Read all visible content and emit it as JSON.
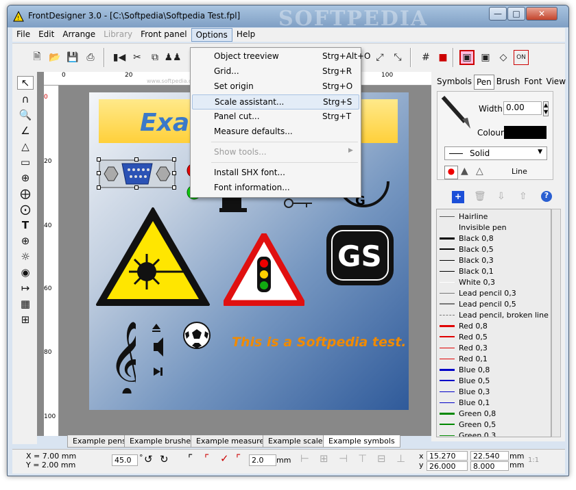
{
  "window": {
    "title": "FrontDesigner 3.0 - [C:\\Softpedia\\Softpedia Test.fpl]",
    "watermark": "SOFTPEDIA"
  },
  "menubar": {
    "items": [
      "File",
      "Edit",
      "Arrange",
      "Library",
      "Front panel",
      "Options",
      "Help"
    ]
  },
  "options_menu": [
    {
      "label": "Object treeview",
      "shortcut": "Strg+Alt+O"
    },
    {
      "label": "Grid...",
      "shortcut": "Strg+R"
    },
    {
      "label": "Set origin",
      "shortcut": "Strg+O"
    },
    {
      "label": "Scale assistant...",
      "shortcut": "Strg+S"
    },
    {
      "label": "Panel cut...",
      "shortcut": "Strg+T"
    },
    {
      "label": "Measure defaults...",
      "shortcut": ""
    },
    {
      "label": "Show tools...",
      "shortcut": ""
    },
    {
      "label": "Install SHX font...",
      "shortcut": ""
    },
    {
      "label": "Font information...",
      "shortcut": ""
    }
  ],
  "ruler": {
    "unit": "mm",
    "h_ticks": [
      "0",
      "20",
      "100"
    ],
    "v_ticks": [
      "0",
      "20",
      "40",
      "60",
      "80",
      "100"
    ],
    "faint": "www.softpedia.com"
  },
  "panel": {
    "banner": "Examp",
    "text": "This is a Softpedia test."
  },
  "bottom_tabs": [
    "Example pens",
    "Example brushes",
    "Example measures",
    "Example scales",
    "Example symbols"
  ],
  "right_panel": {
    "tabs": [
      "Symbols",
      "Pen",
      "Brush",
      "Font",
      "View"
    ],
    "width_label": "Width:",
    "width_value": "0.00",
    "colour_label": "Colour:",
    "line_style": "Solid",
    "line_label": "Line",
    "pens": [
      {
        "name": "Hairline",
        "color": "#555555",
        "w": 1,
        "dash": false
      },
      {
        "name": "Invisible pen",
        "color": "transparent",
        "w": 1,
        "dash": false
      },
      {
        "name": "Black 0,8",
        "color": "#000000",
        "w": 3,
        "dash": false
      },
      {
        "name": "Black 0,5",
        "color": "#000000",
        "w": 2,
        "dash": false
      },
      {
        "name": "Black 0,3",
        "color": "#000000",
        "w": 1,
        "dash": false
      },
      {
        "name": "Black 0,1",
        "color": "#000000",
        "w": 1,
        "dash": false
      },
      {
        "name": "White 0,3",
        "color": "#ffffff",
        "w": 1,
        "dash": false
      },
      {
        "name": "Lead pencil 0,3",
        "color": "#777777",
        "w": 1,
        "dash": false
      },
      {
        "name": "Lead pencil 0,5",
        "color": "#777777",
        "w": 2,
        "dash": false
      },
      {
        "name": "Lead pencil, broken line",
        "color": "#777777",
        "w": 1,
        "dash": true
      },
      {
        "name": "Red 0,8",
        "color": "#e00000",
        "w": 3,
        "dash": false
      },
      {
        "name": "Red 0,5",
        "color": "#e00000",
        "w": 2,
        "dash": false
      },
      {
        "name": "Red 0,3",
        "color": "#e00000",
        "w": 1,
        "dash": false
      },
      {
        "name": "Red 0,1",
        "color": "#e00000",
        "w": 1,
        "dash": false
      },
      {
        "name": "Blue 0,8",
        "color": "#0000c8",
        "w": 3,
        "dash": false
      },
      {
        "name": "Blue 0,5",
        "color": "#0000c8",
        "w": 2,
        "dash": false
      },
      {
        "name": "Blue 0,3",
        "color": "#0000c8",
        "w": 1,
        "dash": false
      },
      {
        "name": "Blue 0,1",
        "color": "#0000c8",
        "w": 1,
        "dash": false
      },
      {
        "name": "Green 0,8",
        "color": "#008800",
        "w": 3,
        "dash": false
      },
      {
        "name": "Green 0,5",
        "color": "#008800",
        "w": 2,
        "dash": false
      },
      {
        "name": "Green 0,3",
        "color": "#008800",
        "w": 1,
        "dash": false
      }
    ]
  },
  "status": {
    "x": "X = 7.00 mm",
    "y": "Y = 2.00 mm",
    "angle": "45.0",
    "angle_unit": "°",
    "radius": "2.0",
    "radius_unit": "mm",
    "px_label": "x",
    "py_label": "y",
    "px": "15.270",
    "py": "26.000",
    "w": "22.540",
    "h": "8.000",
    "unit": "mm",
    "ratio": "1:1"
  }
}
